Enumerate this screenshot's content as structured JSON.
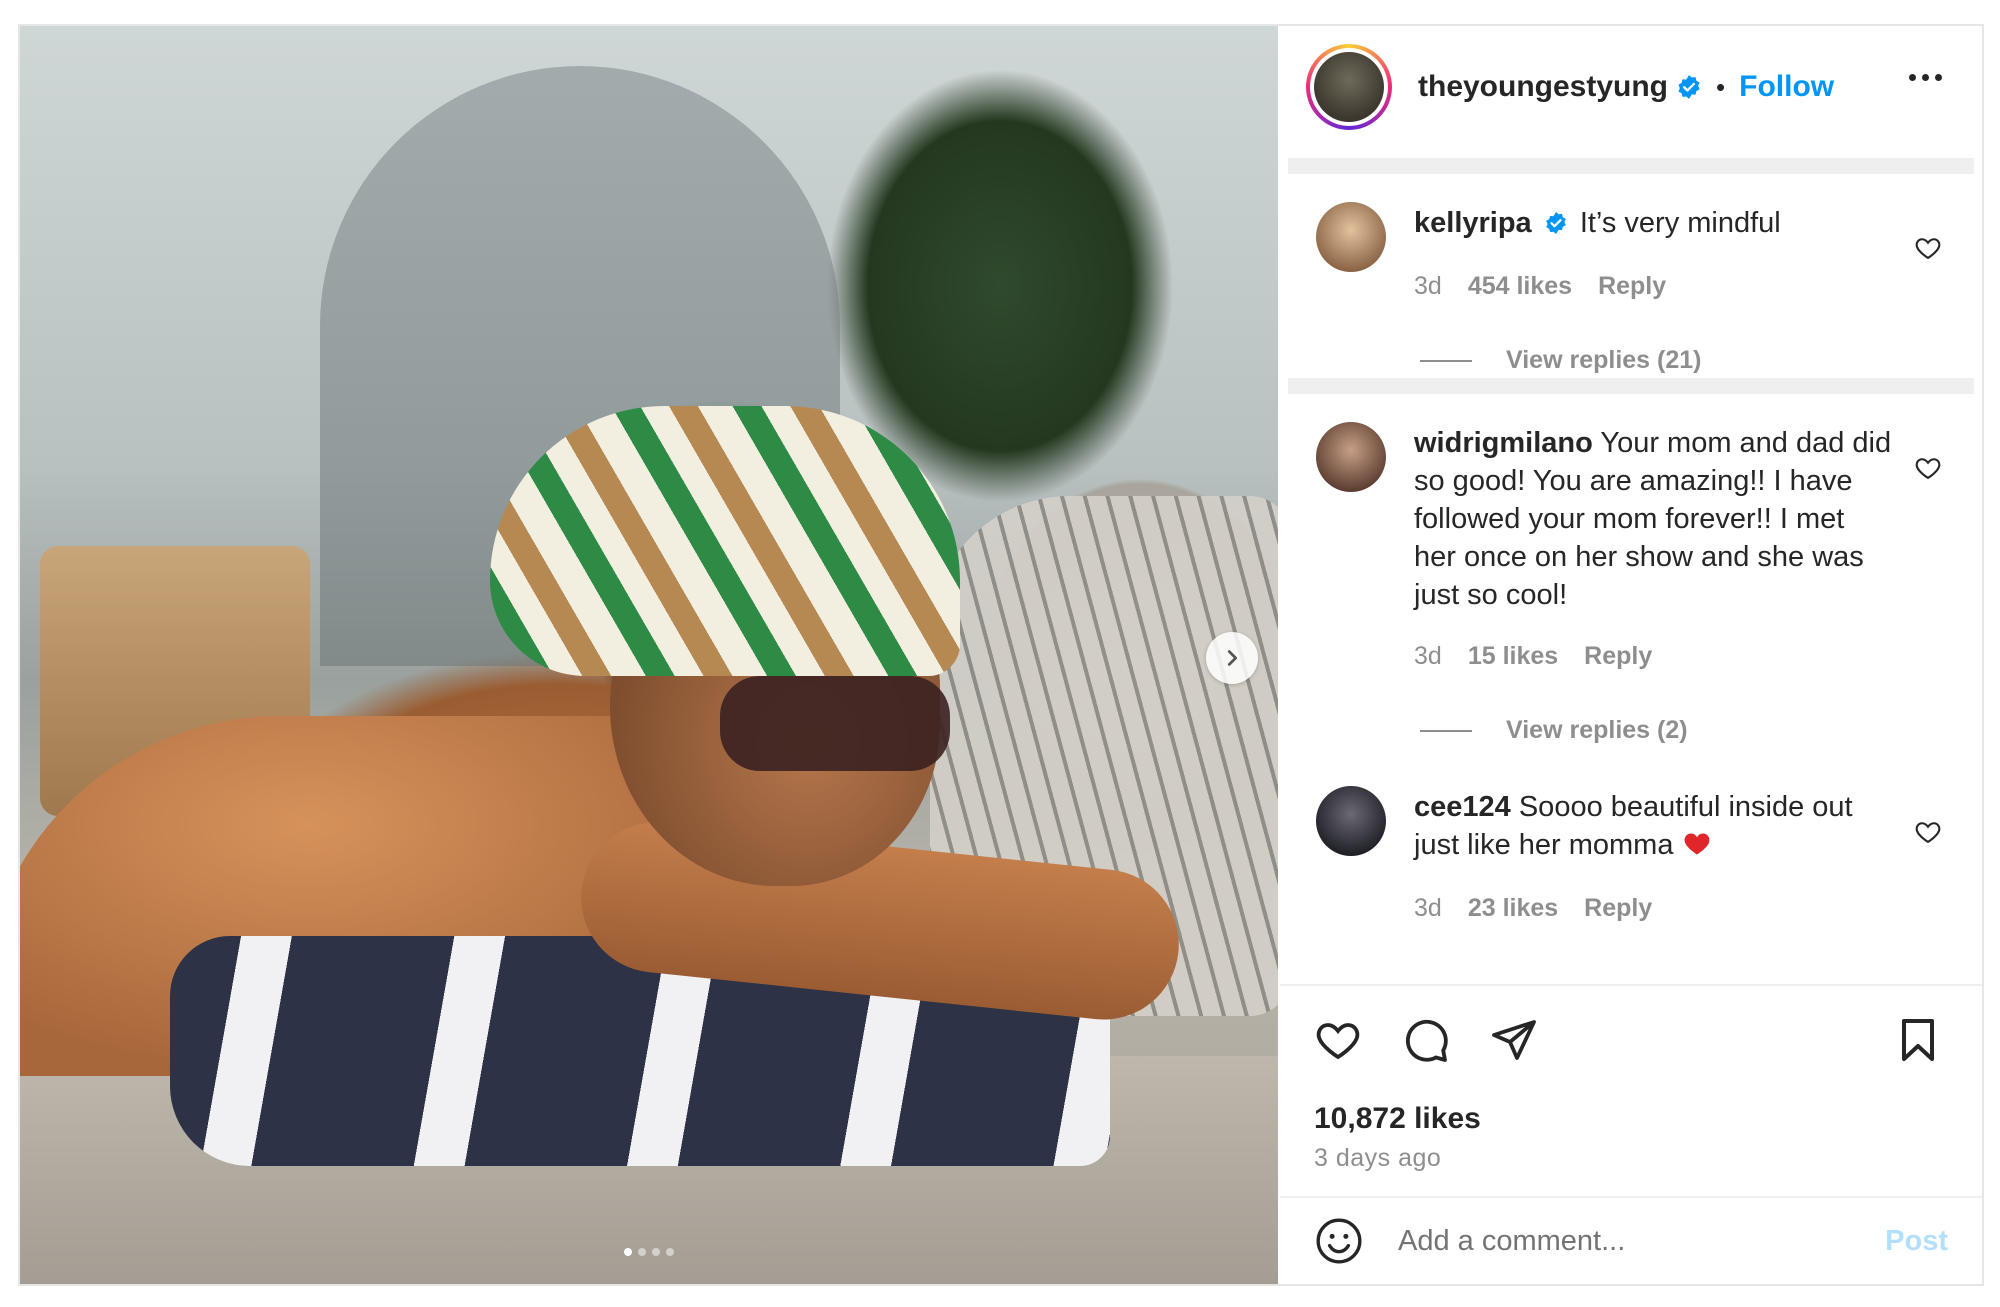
{
  "post": {
    "image_dots": 4,
    "active_dot": 0
  },
  "header": {
    "username": "theyoungestyung",
    "separator": "•",
    "follow_label": "Follow"
  },
  "comments": [
    {
      "username": "kellyripa",
      "verified": true,
      "text": "It’s very mindful",
      "age": "3d",
      "likes": "454 likes",
      "reply_label": "Reply",
      "view_replies": "View replies (21)",
      "avatar_color": "#c89a72"
    },
    {
      "username": "widrigmilano",
      "verified": false,
      "text": "Your mom and dad did so good! You are amazing!! I have followed your mom forever!! I met her once on her show and she was just so cool!",
      "age": "3d",
      "likes": "15 likes",
      "reply_label": "Reply",
      "view_replies": "View replies (2)",
      "avatar_color": "#7a5a4a"
    },
    {
      "username": "cee124",
      "verified": false,
      "text": "Soooo beautiful inside out just like her momma",
      "age": "3d",
      "likes": "23 likes",
      "reply_label": "Reply",
      "avatar_color": "#3a3a44"
    }
  ],
  "actions": {
    "like_icon": "heart-icon",
    "comment_icon": "comment-icon",
    "share_icon": "send-icon",
    "save_icon": "bookmark-icon"
  },
  "stats": {
    "likes": "10,872 likes",
    "time_ago": "3 days ago"
  },
  "add_comment": {
    "placeholder": "Add a comment...",
    "post_label": "Post"
  },
  "colors": {
    "accent": "#0095f6",
    "post_disabled": "#b2dffc",
    "muted": "#8e8e8e",
    "text": "#262626"
  }
}
